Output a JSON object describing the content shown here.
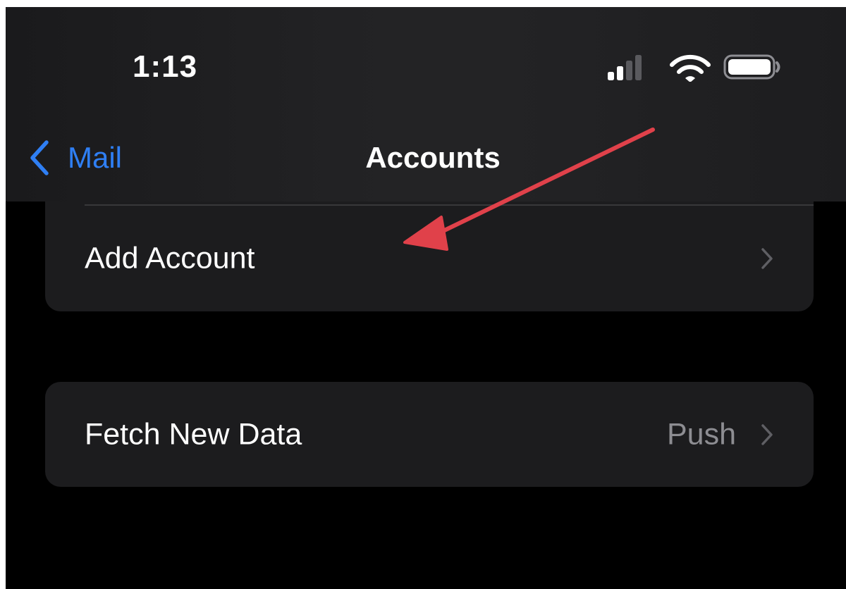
{
  "status_bar": {
    "time": "1:13",
    "signal_icon": "cellular-signal-icon",
    "wifi_icon": "wifi-icon",
    "battery_icon": "battery-icon"
  },
  "nav": {
    "back_label": "Mail",
    "back_icon": "chevron-left-icon",
    "title": "Accounts"
  },
  "rows": {
    "add_account": {
      "label": "Add Account",
      "chevron_icon": "chevron-right-icon"
    },
    "fetch_new_data": {
      "label": "Fetch New Data",
      "value": "Push",
      "chevron_icon": "chevron-right-icon"
    }
  },
  "annotation": {
    "arrow_icon": "red-arrow-icon",
    "color": "#e0414a"
  },
  "colors": {
    "accent": "#2f7ff4",
    "background": "#000000",
    "group_background": "#1c1c1e",
    "secondary_text": "#8d8d92"
  }
}
